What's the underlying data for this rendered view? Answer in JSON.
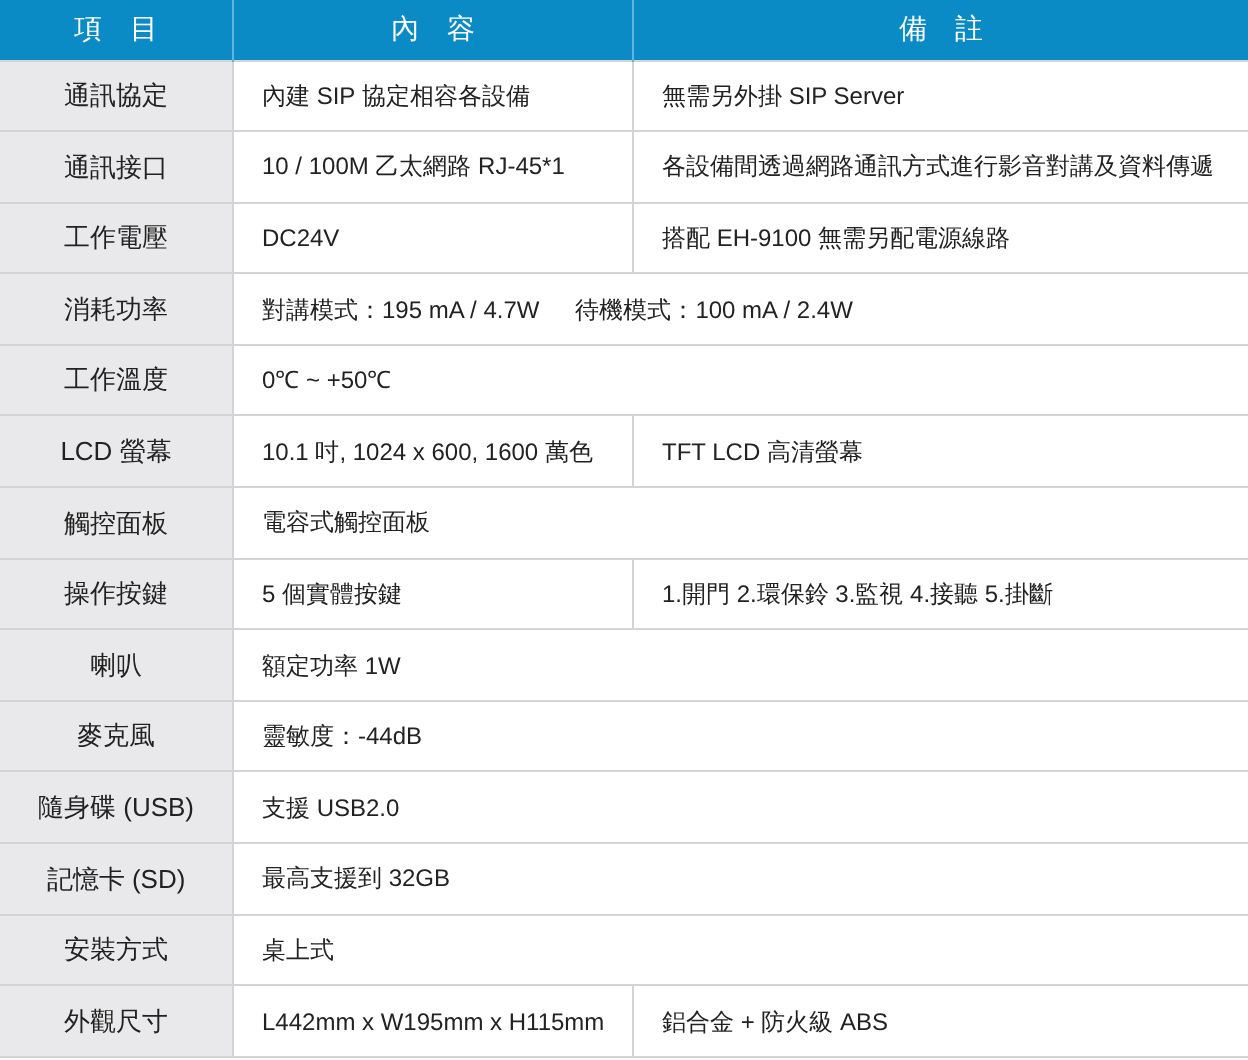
{
  "table": {
    "columns": [
      "項　目",
      "內　容",
      "備　註"
    ],
    "rows": [
      {
        "item": "通訊協定",
        "content": [
          "內建 SIP 協定相容各設備"
        ],
        "note": "無需另外掛 SIP Server"
      },
      {
        "item": "通訊接口",
        "content": [
          "10 / 100M 乙太網路 RJ-45*1"
        ],
        "note": "各設備間透過網路通訊方式進行影音對講及資料傳遞"
      },
      {
        "item": "工作電壓",
        "content": [
          "DC24V"
        ],
        "note": "搭配 EH-9100 無需另配電源線路"
      },
      {
        "item": "消耗功率",
        "content": [
          "對講模式：195 mA / 4.7W",
          "待機模式：100 mA / 2.4W"
        ]
      },
      {
        "item": "工作溫度",
        "content": [
          "0℃ ~ +50℃"
        ]
      },
      {
        "item": "LCD 螢幕",
        "content": [
          "10.1 吋, 1024 x 600, 1600 萬色"
        ],
        "note": "TFT  LCD 高清螢幕"
      },
      {
        "item": "觸控面板",
        "content": [
          "電容式觸控面板"
        ]
      },
      {
        "item": "操作按鍵",
        "content": [
          "5 個實體按鍵"
        ],
        "note": "1.開門  2.環保鈴  3.監視  4.接聽  5.掛斷"
      },
      {
        "item": "喇叭",
        "content": [
          "額定功率 1W"
        ]
      },
      {
        "item": "麥克風",
        "content": [
          "靈敏度：-44dB"
        ]
      },
      {
        "item": "隨身碟 (USB)",
        "content": [
          "支援 USB2.0"
        ]
      },
      {
        "item": "記憶卡 (SD)",
        "content": [
          "最高支援到 32GB"
        ]
      },
      {
        "item": "安裝方式",
        "content": [
          "桌上式"
        ]
      },
      {
        "item": "外觀尺寸",
        "content": [
          "L442mm x W195mm x H115mm"
        ],
        "note": "鋁合金 + 防火級 ABS"
      }
    ]
  }
}
